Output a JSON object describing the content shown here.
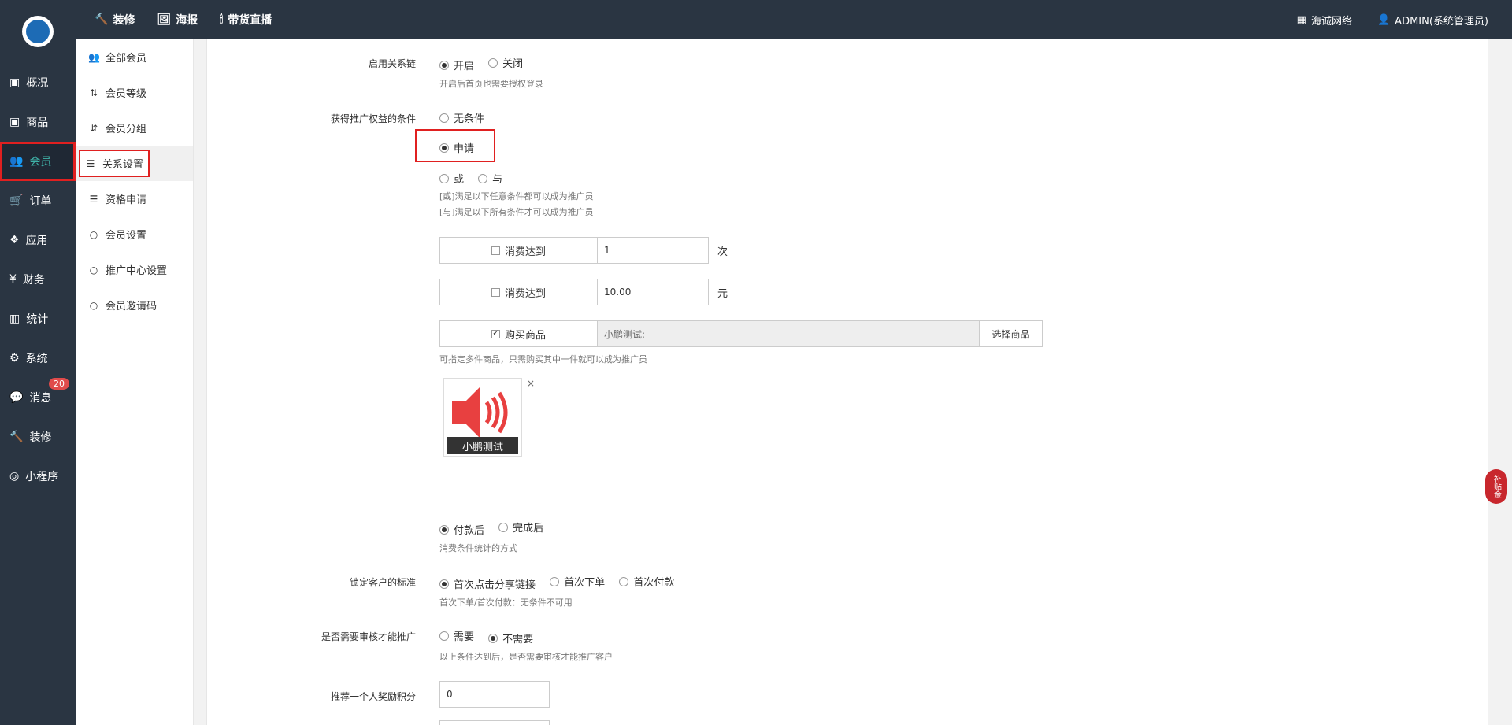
{
  "topbar": {
    "nav": [
      {
        "label": "装修",
        "icon": "hammer-icon"
      },
      {
        "label": "海报",
        "icon": "image-icon"
      },
      {
        "label": "带货直播",
        "icon": "torch-icon"
      }
    ],
    "right": [
      {
        "label": "海诚网络",
        "icon": "grid-icon"
      },
      {
        "label": "ADMIN(系统管理员)",
        "icon": "user-icon"
      }
    ]
  },
  "sidebar": {
    "items": [
      {
        "label": "概况",
        "icon": "box-icon"
      },
      {
        "label": "商品",
        "icon": "box-icon"
      },
      {
        "label": "会员",
        "icon": "users-icon"
      },
      {
        "label": "订单",
        "icon": "cart-icon"
      },
      {
        "label": "应用",
        "icon": "cubes-icon"
      },
      {
        "label": "财务",
        "icon": "yen-icon"
      },
      {
        "label": "统计",
        "icon": "chart-icon"
      },
      {
        "label": "系统",
        "icon": "gears-icon"
      },
      {
        "label": "消息",
        "icon": "comment-icon",
        "badge": "20"
      },
      {
        "label": "装修",
        "icon": "hammer-icon"
      },
      {
        "label": "小程序",
        "icon": "wechat-icon"
      }
    ]
  },
  "submenu": {
    "items": [
      {
        "label": "全部会员",
        "icon": "users-icon"
      },
      {
        "label": "会员等级",
        "icon": "sort-icon"
      },
      {
        "label": "会员分组",
        "icon": "sort-num-icon"
      },
      {
        "label": "关系设置",
        "icon": "sliders-icon"
      },
      {
        "label": "资格申请",
        "icon": "sliders-icon"
      },
      {
        "label": "会员设置",
        "icon": "circle-icon"
      },
      {
        "label": "推广中心设置",
        "icon": "circle-icon"
      },
      {
        "label": "会员邀请码",
        "icon": "circle-icon"
      }
    ]
  },
  "form": {
    "chain": {
      "label": "启用关系链",
      "on": "开启",
      "off": "关闭",
      "help": "开启后首页也需要授权登录"
    },
    "condition": {
      "label": "获得推广权益的条件",
      "none": "无条件",
      "apply": "申请",
      "or": "或",
      "and": "与",
      "help_or": "[或]满足以下任意条件都可以成为推广员",
      "help_and": "[与]满足以下所有条件才可以成为推广员"
    },
    "consume_count": {
      "label": "消费达到",
      "value": "1",
      "suffix": "次"
    },
    "consume_amount": {
      "label": "消费达到",
      "value": "10.00",
      "suffix": "元"
    },
    "buy_goods": {
      "label": "购买商品",
      "value": "小鹏测试;",
      "button": "选择商品",
      "help": "可指定多件商品，只需购买其中一件就可以成为推广员"
    },
    "goods_thumb": {
      "caption": "小鹏测试",
      "close": "×"
    },
    "stat_method": {
      "after_pay": "付款后",
      "after_done": "完成后",
      "help": "消费条件统计的方式"
    },
    "lock": {
      "label": "锁定客户的标准",
      "o1": "首次点击分享链接",
      "o2": "首次下单",
      "o3": "首次付款",
      "help": "首次下单/首次付款：无条件不可用"
    },
    "review": {
      "label": "是否需要审核才能推广",
      "yes": "需要",
      "no": "不需要",
      "help": "以上条件达到后，是否需要审核才能推广客户"
    },
    "reward": {
      "label": "推荐一个人奖励积分",
      "value": "0"
    }
  },
  "float_badge": "补贴金"
}
